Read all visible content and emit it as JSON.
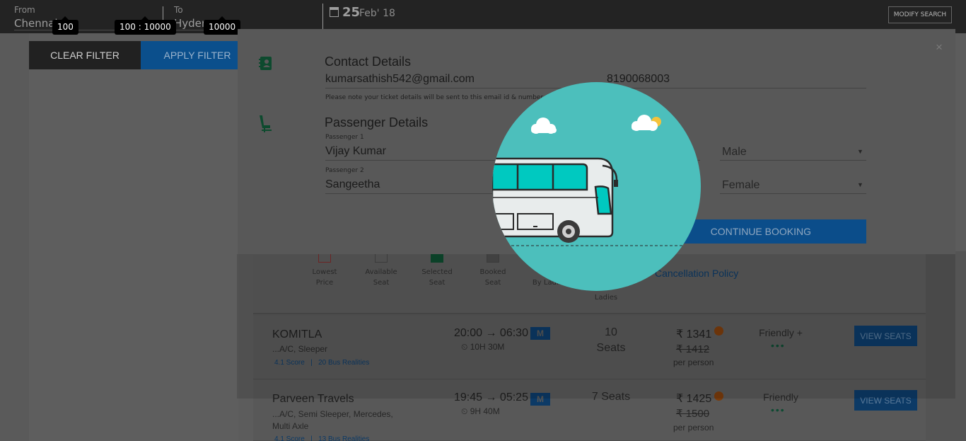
{
  "topbar": {
    "from_label": "From",
    "from_value": "Chennai",
    "to_label": "To",
    "to_value": "Hyder",
    "date_day": "25",
    "date_rest": "Feb' 18",
    "modify_label": "MODIFY SEARCH"
  },
  "slider_tips": {
    "min": "100",
    "range": "100 : 10000",
    "max": "10000"
  },
  "filter": {
    "clear_label": "CLEAR FILTER",
    "apply_label": "APPLY FILTER"
  },
  "modal": {
    "close": "×",
    "contact_title": "Contact Details",
    "email": "kumarsathish542@gmail.com",
    "phone": "8190068003",
    "note": "Please note your ticket details will be sent to this email id & number",
    "passenger_title": "Passenger Details",
    "passengers": [
      {
        "label": "Passenger 1",
        "name": "Vijay Kumar",
        "gender": "Male"
      },
      {
        "label": "Passenger 2",
        "name": "Sangeetha",
        "gender": "Female"
      }
    ],
    "continue_label": "CONTINUE BOOKING"
  },
  "legend": {
    "items": [
      {
        "line1": "Lowest",
        "line2": "Price"
      },
      {
        "line1": "Available",
        "line2": "Seat"
      },
      {
        "line1": "Selected",
        "line2": "Seat"
      },
      {
        "line1": "Booked",
        "line2": "Seat"
      },
      {
        "line1": "B",
        "line2": "By Ladies"
      }
    ],
    "ladies_label": "Ladies",
    "cancellation_link": "Cancellation Policy"
  },
  "buses": [
    {
      "name": "KOMITLA",
      "type": "...A/C, Sleeper",
      "score": "4.1 Score",
      "realities": "20 Bus Realities",
      "time": "20:00 → 06:30",
      "duration": "10H 30M",
      "seats_line1": "10",
      "seats_line2": "Seats",
      "price": "₹ 1341",
      "old_price": "₹ 1412",
      "per_person": "per person",
      "rating": "Friendly +",
      "view_label": "VIEW SEATS"
    },
    {
      "name": "Parveen Travels",
      "type_line1": "...A/C, Semi Sleeper, Mercedes,",
      "type_line2": "Multi Axle",
      "score": "4.1 Score",
      "realities": "13 Bus Realities",
      "time": "19:45 → 05:25",
      "duration": "9H 40M",
      "seats": "7 Seats",
      "price": "₹ 1425",
      "old_price": "₹ 1500",
      "per_person": "per person",
      "rating": "Friendly",
      "view_label": "VIEW SEATS"
    }
  ],
  "colors": {
    "topbar": "#232323",
    "primary_blue": "#0b4f8c",
    "loader_teal": "#4cbfbc",
    "bus_accent": "#00c9c0",
    "overlay": "#5c5c5c"
  }
}
